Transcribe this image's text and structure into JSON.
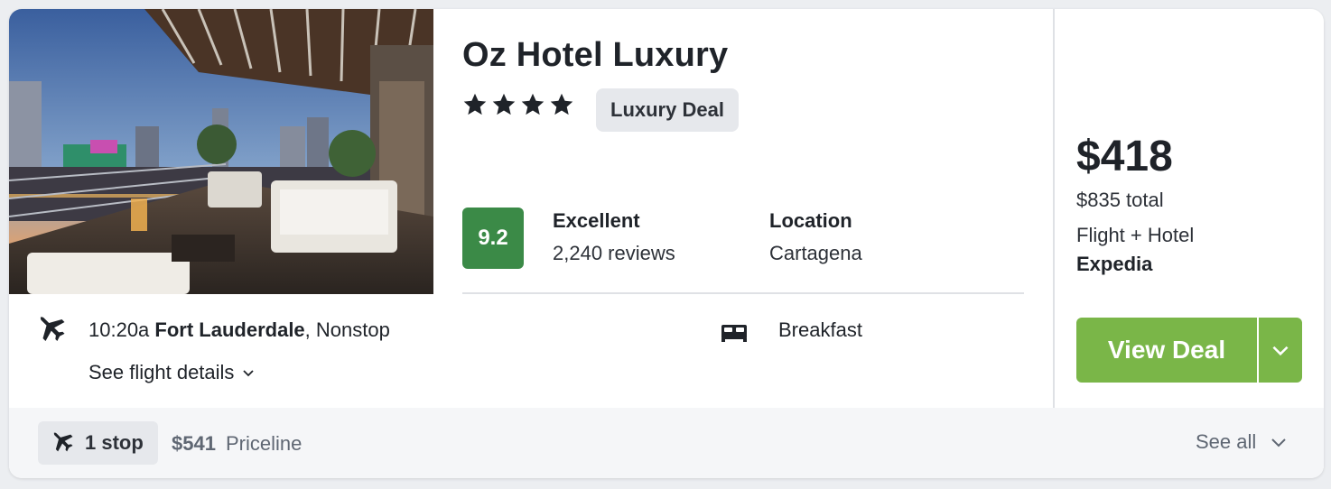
{
  "hotel": {
    "name": "Oz Hotel Luxury",
    "stars": 4,
    "badge": "Luxury Deal"
  },
  "rating": {
    "score": "9.2",
    "label": "Excellent",
    "reviews": "2,240 reviews",
    "color": "#3b8a47"
  },
  "location": {
    "label": "Location",
    "value": "Cartagena"
  },
  "flight": {
    "time": "10:20a",
    "airport": "Fort Lauderdale",
    "type": ", Nonstop",
    "details_link": "See flight details"
  },
  "amenity": {
    "icon": "bed-icon",
    "label": "Breakfast"
  },
  "price": {
    "amount": "$418",
    "total": "$835 total",
    "package": "Flight + Hotel",
    "provider": "Expedia"
  },
  "cta": {
    "label": "View Deal",
    "color": "#7ab648"
  },
  "footer": {
    "stops": "1 stop",
    "alt_price": "$541",
    "alt_provider": "Priceline",
    "see_all": "See all"
  },
  "icons": {
    "plane": "plane-icon",
    "chevron": "chevron-down-icon",
    "star": "star-icon"
  }
}
